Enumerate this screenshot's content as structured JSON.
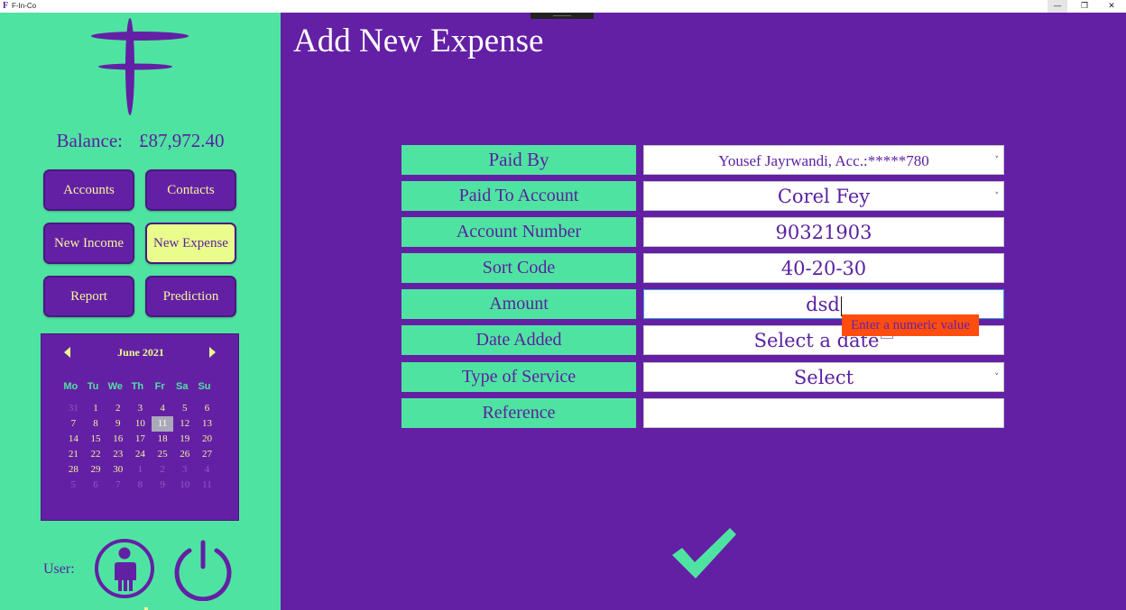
{
  "window": {
    "title": "F-In-Co",
    "icon": "F",
    "minimize_glyph": "—",
    "maximize_glyph": "❐",
    "close_glyph": "✕"
  },
  "sidebar": {
    "balance_label": "Balance:",
    "balance_value": "£87,972.40",
    "nav": {
      "accounts": "Accounts",
      "contacts": "Contacts",
      "new_income": "New Income",
      "new_expense": "New Expense",
      "report": "Report",
      "prediction": "Prediction"
    },
    "active_nav": "new_expense",
    "calendar": {
      "month": "June 2021",
      "weekdays": [
        "Mo",
        "Tu",
        "We",
        "Th",
        "Fr",
        "Sa",
        "Su"
      ],
      "days": [
        {
          "d": "31",
          "muted": true
        },
        {
          "d": "1"
        },
        {
          "d": "2"
        },
        {
          "d": "3"
        },
        {
          "d": "4"
        },
        {
          "d": "5"
        },
        {
          "d": "6"
        },
        {
          "d": "7"
        },
        {
          "d": "8"
        },
        {
          "d": "9"
        },
        {
          "d": "10"
        },
        {
          "d": "11",
          "today": true
        },
        {
          "d": "12"
        },
        {
          "d": "13"
        },
        {
          "d": "14"
        },
        {
          "d": "15"
        },
        {
          "d": "16"
        },
        {
          "d": "17"
        },
        {
          "d": "18"
        },
        {
          "d": "19"
        },
        {
          "d": "20"
        },
        {
          "d": "21"
        },
        {
          "d": "22"
        },
        {
          "d": "23"
        },
        {
          "d": "24"
        },
        {
          "d": "25"
        },
        {
          "d": "26"
        },
        {
          "d": "27"
        },
        {
          "d": "28"
        },
        {
          "d": "29"
        },
        {
          "d": "30"
        },
        {
          "d": "1",
          "muted": true
        },
        {
          "d": "2",
          "muted": true
        },
        {
          "d": "3",
          "muted": true
        },
        {
          "d": "4",
          "muted": true
        },
        {
          "d": "5",
          "muted": true
        },
        {
          "d": "6",
          "muted": true
        },
        {
          "d": "7",
          "muted": true
        },
        {
          "d": "8",
          "muted": true
        },
        {
          "d": "9",
          "muted": true
        },
        {
          "d": "10",
          "muted": true
        },
        {
          "d": "11",
          "muted": true
        }
      ]
    },
    "user_label": "User:"
  },
  "main": {
    "title": "Add New Expense",
    "form": {
      "paid_by": {
        "label": "Paid By",
        "value": "Yousef Jayrwandi, Acc.:*****780"
      },
      "paid_to": {
        "label": "Paid To Account",
        "value": "Corel Fey"
      },
      "account_number": {
        "label": "Account Number",
        "value": "90321903"
      },
      "sort_code": {
        "label": "Sort Code",
        "value": "40-20-30"
      },
      "amount": {
        "label": "Amount",
        "value": "dsd",
        "error": "Enter a numeric value"
      },
      "date_added": {
        "label": "Date Added",
        "placeholder": "Select a date"
      },
      "service_type": {
        "label": "Type of Service",
        "value": "Select"
      },
      "reference": {
        "label": "Reference",
        "value": ""
      }
    },
    "dropdown_arrow": "˅"
  },
  "colors": {
    "purple": "#6420a5",
    "green": "#4fe3a2",
    "yellow": "#e9fc8c",
    "error": "#ff4d0d"
  },
  "icons": {
    "logo": "finco-logo-icon",
    "user": "user-icon",
    "power": "power-icon",
    "confirm": "checkmark-icon",
    "prev_month": "chevron-left-icon",
    "next_month": "chevron-right-icon"
  }
}
